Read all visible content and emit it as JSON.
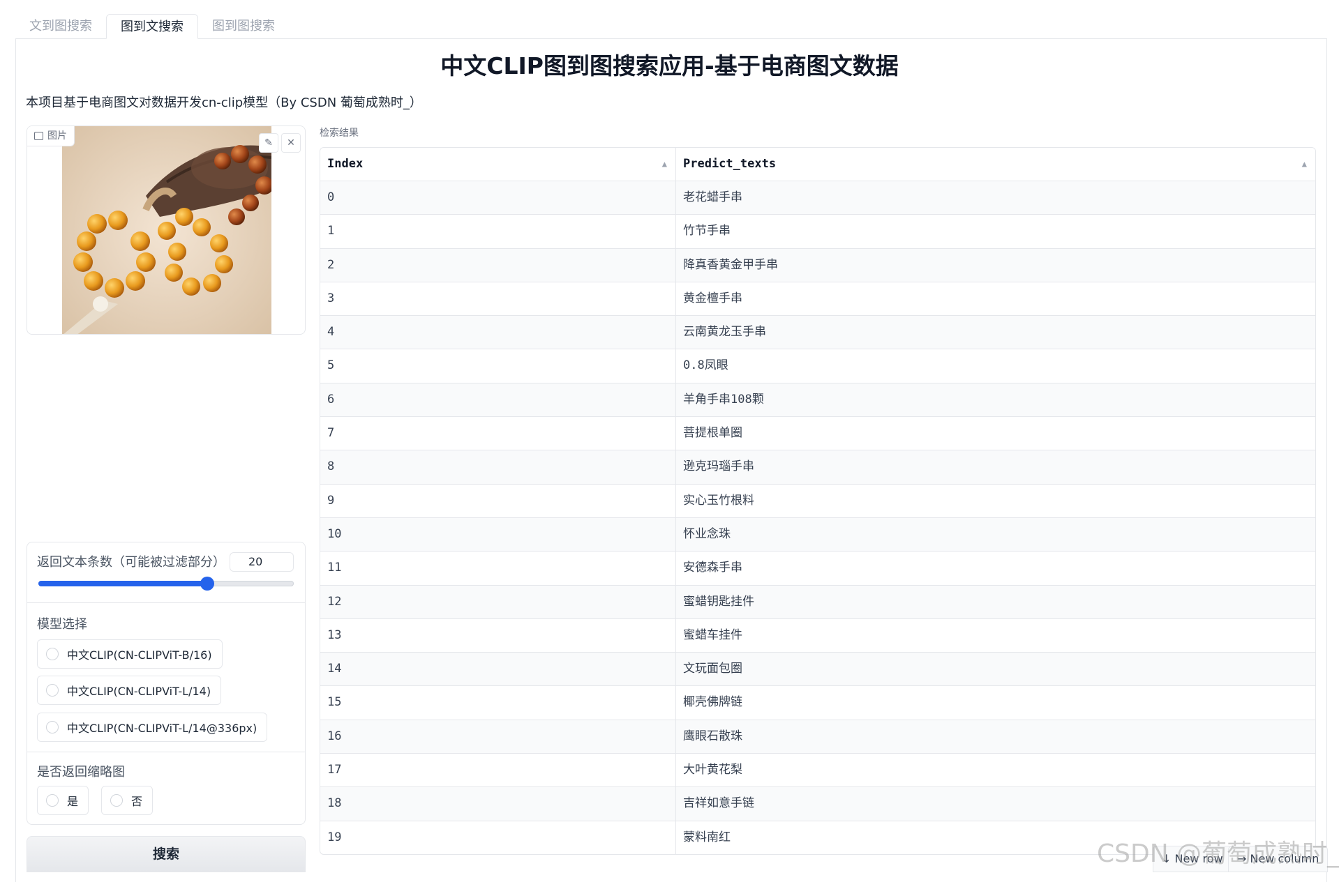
{
  "tabs": [
    {
      "label": "文到图搜索",
      "active": false
    },
    {
      "label": "图到文搜索",
      "active": true
    },
    {
      "label": "图到图搜索",
      "active": false
    }
  ],
  "header": {
    "title": "中文CLIP图到图搜索应用-基于电商图文数据",
    "description": "本项目基于电商图文对数据开发cn-clip模型（By CSDN 葡萄成熟时_）"
  },
  "image_input": {
    "label": "图片",
    "edit_icon": "pencil-icon",
    "clear_icon": "close-icon"
  },
  "slider": {
    "label": "返回文本条数（可能被过滤部分）",
    "value": "20",
    "fraction": 0.66
  },
  "model_select": {
    "label": "模型选择",
    "options": [
      "中文CLIP(CN-CLIPViT-B/16)",
      "中文CLIP(CN-CLIPViT-L/14)",
      "中文CLIP(CN-CLIPViT-L/14@336px)"
    ]
  },
  "thumbnail_select": {
    "label": "是否返回缩略图",
    "options": [
      "是",
      "否"
    ]
  },
  "search_button": {
    "label": "搜索"
  },
  "results": {
    "label": "检索结果",
    "columns": [
      "Index",
      "Predict_texts"
    ],
    "rows": [
      [
        "0",
        "老花蜡手串"
      ],
      [
        "1",
        "竹节手串"
      ],
      [
        "2",
        "降真香黄金甲手串"
      ],
      [
        "3",
        "黄金檀手串"
      ],
      [
        "4",
        "云南黄龙玉手串"
      ],
      [
        "5",
        "0.8凤眼"
      ],
      [
        "6",
        "羊角手串108颗"
      ],
      [
        "7",
        "菩提根单圈"
      ],
      [
        "8",
        "逊克玛瑙手串"
      ],
      [
        "9",
        "实心玉竹根料"
      ],
      [
        "10",
        "怀业念珠"
      ],
      [
        "11",
        "安德森手串"
      ],
      [
        "12",
        "蜜蜡钥匙挂件"
      ],
      [
        "13",
        "蜜蜡车挂件"
      ],
      [
        "14",
        "文玩面包圈"
      ],
      [
        "15",
        "椰壳佛牌链"
      ],
      [
        "16",
        "鹰眼石散珠"
      ],
      [
        "17",
        "大叶黄花梨"
      ],
      [
        "18",
        "吉祥如意手链"
      ],
      [
        "19",
        "蒙料南红"
      ]
    ],
    "new_row_label": "↓ New row",
    "new_column_label": "→ New column"
  },
  "watermark": "CSDN @葡萄成熟时_",
  "colors": {
    "accent": "#2563eb",
    "border": "#e5e7eb"
  }
}
